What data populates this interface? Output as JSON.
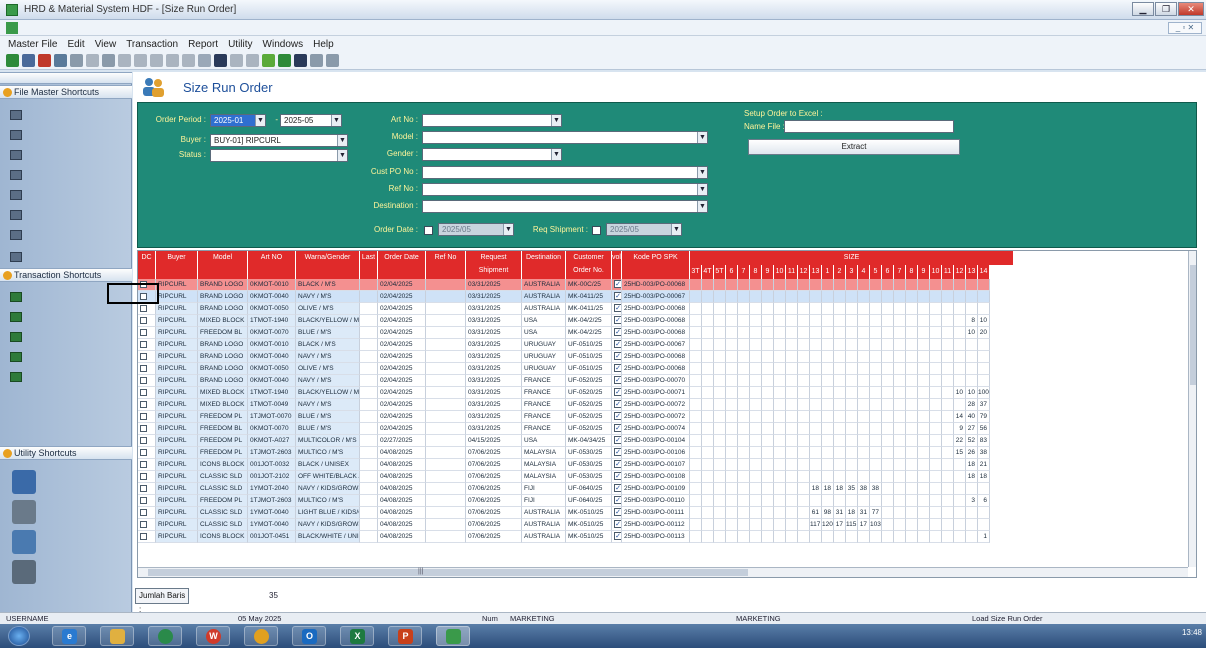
{
  "window": {
    "title": "HRD & Material System HDF - [Size Run Order]"
  },
  "menu": [
    "Master File",
    "Edit",
    "View",
    "Transaction",
    "Report",
    "Utility",
    "Windows",
    "Help"
  ],
  "sidebar": {
    "master_head": "File Master Shortcuts",
    "master_items": [
      "",
      "",
      "",
      "",
      "",
      "",
      "",
      ""
    ],
    "trans_head": "Transaction Shortcuts",
    "trans_items": [
      "",
      "",
      "",
      "",
      ""
    ],
    "utility_head": "Utility Shortcuts",
    "utility_items": [
      "",
      "",
      "",
      ""
    ]
  },
  "page": {
    "title": "Size Run Order"
  },
  "filters": {
    "order_period_label": "Order Period :",
    "period_from": "2025-01",
    "period_to": "2025-05",
    "buyer_label": "Buyer :",
    "buyer_value": "BUY-01] RIPCURL",
    "status_label": "Status :",
    "status_value": "",
    "artno_label": "Art No :",
    "model_label": "Model :",
    "gender_label": "Gender :",
    "custpo_label": "Cust PO No :",
    "refno_label": "Ref No :",
    "destination_label": "Destination :",
    "order_date_label": "Order Date :",
    "order_date_value": "2025/05",
    "req_shipment_label": "Req Shipment :",
    "req_shipment_value": "2025/05",
    "excel_label": "Setup Order to Excel :",
    "name_file_label": "Name File :",
    "extract_label": "Extract"
  },
  "grid": {
    "headers": [
      "DC",
      "Buyer",
      "Model",
      "Art NO",
      "Warna/Gender",
      "Last",
      "Order Date",
      "Ref No",
      "Request Shipment",
      "Destination",
      "Customer Order No.",
      "vol",
      "Kode PO SPK"
    ],
    "size_label": "SIZE",
    "sizes": [
      "3T",
      "4T",
      "5T",
      "6",
      "7",
      "8",
      "9",
      "10",
      "11",
      "12",
      "13",
      "1",
      "2",
      "3",
      "4",
      "5",
      "6",
      "7",
      "8",
      "9",
      "10",
      "11",
      "12",
      "13",
      "14"
    ],
    "rows": [
      [
        "",
        "RIPCURL",
        "BRAND LOGO",
        "0KMOT-0010",
        "BLACK / M'S",
        "",
        "02/04/2025",
        "",
        "03/31/2025",
        "AUSTRALIA",
        "MK-00C/25",
        "",
        "25HD-003/PO-00068",
        []
      ],
      [
        "",
        "RIPCURL",
        "BRAND LOGO",
        "0KMOT-0040",
        "NAVY / M'S",
        "",
        "02/04/2025",
        "",
        "03/31/2025",
        "AUSTRALIA",
        "MK-0411/25",
        "",
        "25HD-003/PO-00067",
        []
      ],
      [
        "",
        "RIPCURL",
        "BRAND LOGO",
        "0KMOT-0050",
        "OLIVE / M'S",
        "",
        "02/04/2025",
        "",
        "03/31/2025",
        "AUSTRALIA",
        "MK-0411/25",
        "",
        "25HD-003/PO-00068",
        []
      ],
      [
        "",
        "RIPCURL",
        "MIXED BLOCK",
        "1TMOT-1940",
        "BLACK/YELLOW / M'S",
        "",
        "02/04/2025",
        "",
        "03/31/2025",
        "USA",
        "MK-04/2/25",
        "",
        "25HD-003/PO-00068",
        [
          "8",
          "10"
        ]
      ],
      [
        "",
        "RIPCURL",
        "FREEDOM BL",
        "0KMOT-0070",
        "BLUE / M'S",
        "",
        "02/04/2025",
        "",
        "03/31/2025",
        "USA",
        "MK-04/2/25",
        "",
        "25HD-003/PO-00068",
        [
          "10",
          "20"
        ]
      ],
      [
        "",
        "RIPCURL",
        "BRAND LOGO",
        "0KMOT-0010",
        "BLACK / M'S",
        "",
        "02/04/2025",
        "",
        "03/31/2025",
        "URUGUAY",
        "UF-0510/25",
        "",
        "25HD-003/PO-00067",
        []
      ],
      [
        "",
        "RIPCURL",
        "BRAND LOGO",
        "0KMOT-0040",
        "NAVY / M'S",
        "",
        "02/04/2025",
        "",
        "03/31/2025",
        "URUGUAY",
        "UF-0510/25",
        "",
        "25HD-003/PO-00068",
        []
      ],
      [
        "",
        "RIPCURL",
        "BRAND LOGO",
        "0KMOT-0050",
        "OLIVE / M'S",
        "",
        "02/04/2025",
        "",
        "03/31/2025",
        "URUGUAY",
        "UF-0510/25",
        "",
        "25HD-003/PO-00068",
        []
      ],
      [
        "",
        "RIPCURL",
        "BRAND LOGO",
        "0KMOT-0040",
        "NAVY / M'S",
        "",
        "02/04/2025",
        "",
        "03/31/2025",
        "FRANCE",
        "UF-0520/25",
        "",
        "25HD-003/PO-00070",
        []
      ],
      [
        "",
        "RIPCURL",
        "MIXED BLOCK",
        "1TMOT-1940",
        "BLACK/YELLOW / M'S",
        "",
        "02/04/2025",
        "",
        "03/31/2025",
        "FRANCE",
        "UF-0520/25",
        "",
        "25HD-003/PO-00071",
        [
          "10",
          "10",
          "100"
        ]
      ],
      [
        "",
        "RIPCURL",
        "MIXED BLOCK",
        "1TMOT-0049",
        "NAVY / M'S",
        "",
        "02/04/2025",
        "",
        "03/31/2025",
        "FRANCE",
        "UF-0520/25",
        "",
        "25HD-003/PO-00072",
        [
          "28",
          "37"
        ]
      ],
      [
        "",
        "RIPCURL",
        "FREEDOM PL",
        "1TJMOT-0070",
        "BLUE / M'S",
        "",
        "02/04/2025",
        "",
        "03/31/2025",
        "FRANCE",
        "UF-0520/25",
        "",
        "25HD-003/PO-00072",
        [
          "14",
          "40",
          "79"
        ]
      ],
      [
        "",
        "RIPCURL",
        "FREEDOM BL",
        "0KMOT-0070",
        "BLUE / M'S",
        "",
        "02/04/2025",
        "",
        "03/31/2025",
        "FRANCE",
        "UF-0520/25",
        "",
        "25HD-003/PO-00074",
        [
          "9",
          "27",
          "56"
        ]
      ],
      [
        "",
        "RIPCURL",
        "FREEDOM PL",
        "0KMOT-A027",
        "MULTICOLOR / M'S",
        "",
        "02/27/2025",
        "",
        "04/15/2025",
        "USA",
        "MK-04/34/25",
        "",
        "25HD-003/PO-00104",
        [
          "22",
          "52",
          "83"
        ]
      ],
      [
        "",
        "RIPCURL",
        "FREEDOM PL",
        "1TJMOT-2603",
        "MULTICO / M'S",
        "",
        "04/08/2025",
        "",
        "07/06/2025",
        "MALAYSIA",
        "UF-0530/25",
        "",
        "25HD-003/PO-00106",
        [
          "15",
          "26",
          "38"
        ]
      ],
      [
        "",
        "RIPCURL",
        "ICONS BLOCK",
        "001JOT-0032",
        "BLACK / UNISEX",
        "",
        "04/08/2025",
        "",
        "07/06/2025",
        "MALAYSIA",
        "UF-0530/25",
        "",
        "25HD-003/PO-00107",
        [
          "18",
          "21"
        ]
      ],
      [
        "",
        "RIPCURL",
        "CLASSIC SLD",
        "001JOT-2102",
        "OFF WHITE/BLACK / U",
        "",
        "04/08/2025",
        "",
        "07/06/2025",
        "MALAYSIA",
        "UF-0530/25",
        "",
        "25HD-003/PO-00108",
        [
          "18",
          "18"
        ]
      ],
      [
        "",
        "RIPCURL",
        "CLASSIC SLD",
        "1YMOT-2040",
        "NAVY / KIDS/GROWS",
        "",
        "04/08/2025",
        "",
        "07/06/2025",
        "FIJI",
        "UF-0640/25",
        "",
        "25HD-003/PO-00109",
        []
      ],
      [
        "",
        "RIPCURL",
        "FREEDOM PL",
        "1TJMOT-2603",
        "MULTICO / M'S",
        "",
        "04/08/2025",
        "",
        "07/06/2025",
        "FIJI",
        "UF-0640/25",
        "",
        "25HD-003/PO-00110",
        [
          "3",
          "6"
        ]
      ],
      [
        "",
        "RIPCURL",
        "CLASSIC SLD",
        "1YMOT-0040",
        "LIGHT BLUE / KIDS/G",
        "",
        "04/08/2025",
        "",
        "07/06/2025",
        "AUSTRALIA",
        "MK-0510/25",
        "",
        "25HD-003/PO-00111",
        []
      ],
      [
        "",
        "RIPCURL",
        "CLASSIC SLD",
        "1YMOT-0040",
        "NAVY / KIDS/GROWS",
        "",
        "04/08/2025",
        "",
        "07/06/2025",
        "AUSTRALIA",
        "MK-0510/25",
        "",
        "25HD-003/PO-00112",
        []
      ],
      [
        "",
        "RIPCURL",
        "ICONS BLOCK",
        "001JOT-0451",
        "BLACK/WHITE / UNISI",
        "",
        "04/08/2025",
        "",
        "07/06/2025",
        "AUSTRALIA",
        "MK-0510/25",
        "",
        "25HD-003/PO-00113",
        [
          "1"
        ]
      ]
    ],
    "mid_sizes": [
      {
        "row": 17,
        "vals": [
          "18",
          "18",
          "18",
          "35",
          "38",
          "38"
        ]
      },
      {
        "row": 19,
        "vals": [
          "61",
          "98",
          "31",
          "18",
          "31",
          "77"
        ]
      },
      {
        "row": 20,
        "vals": [
          "117",
          "120",
          "17",
          "115",
          "17",
          "103"
        ]
      }
    ]
  },
  "footer": {
    "total_label": "Jumlah Baris :",
    "total_value": "35"
  },
  "status": {
    "user": "USERNAME",
    "date": "05 May 2025",
    "num": "Num",
    "dept": "MARKETING",
    "dept2": "MARKETING",
    "last_action": "Load Size Run Order"
  },
  "taskbar": {
    "time": "13:48"
  }
}
